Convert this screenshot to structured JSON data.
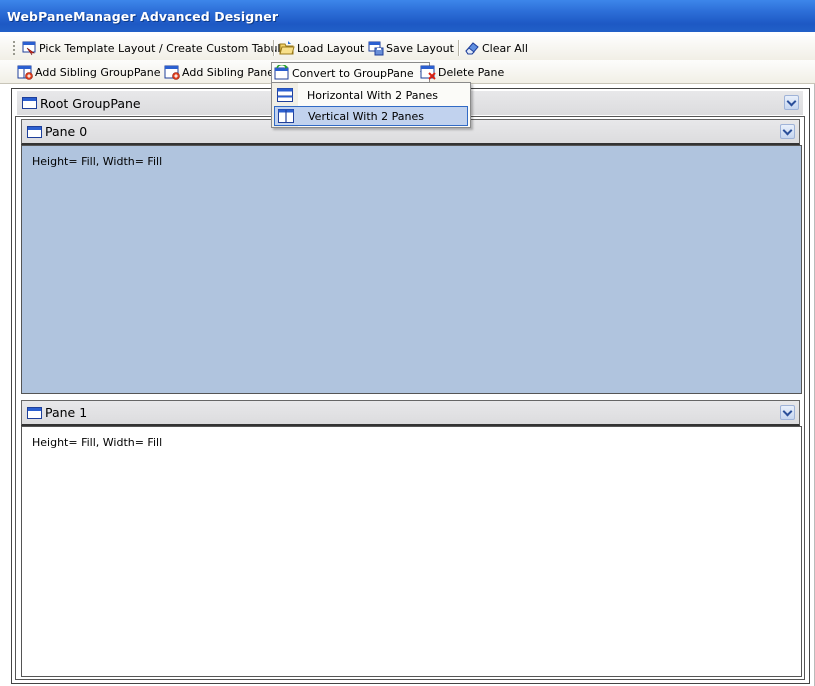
{
  "window": {
    "title": "WebPaneManager Advanced Designer"
  },
  "toolbar1": {
    "pick_template": "Pick Template Layout / Create Custom Tabular",
    "load_layout": "Load Layout",
    "save_layout": "Save Layout",
    "clear_all": "Clear All"
  },
  "toolbar2": {
    "add_sibling_grouppane": "Add Sibling GroupPane",
    "add_sibling_pane": "Add Sibling Pane",
    "convert_to_grouppane": "Convert to GroupPane",
    "delete_pane": "Delete Pane"
  },
  "dropdown": {
    "items": [
      {
        "label": "Horizontal With 2 Panes",
        "icon": "horizontal-split-icon"
      },
      {
        "label": "Vertical With 2 Panes",
        "icon": "vertical-split-icon",
        "highlighted": true
      }
    ]
  },
  "designer": {
    "root": {
      "title": "Root GroupPane"
    },
    "panes": [
      {
        "title": "Pane 0",
        "info": "Height= Fill, Width= Fill",
        "selected": true,
        "bg": "#b0c4de"
      },
      {
        "title": "Pane 1",
        "info": "Height= Fill, Width= Fill",
        "selected": false,
        "bg": "#ffffff"
      }
    ]
  }
}
